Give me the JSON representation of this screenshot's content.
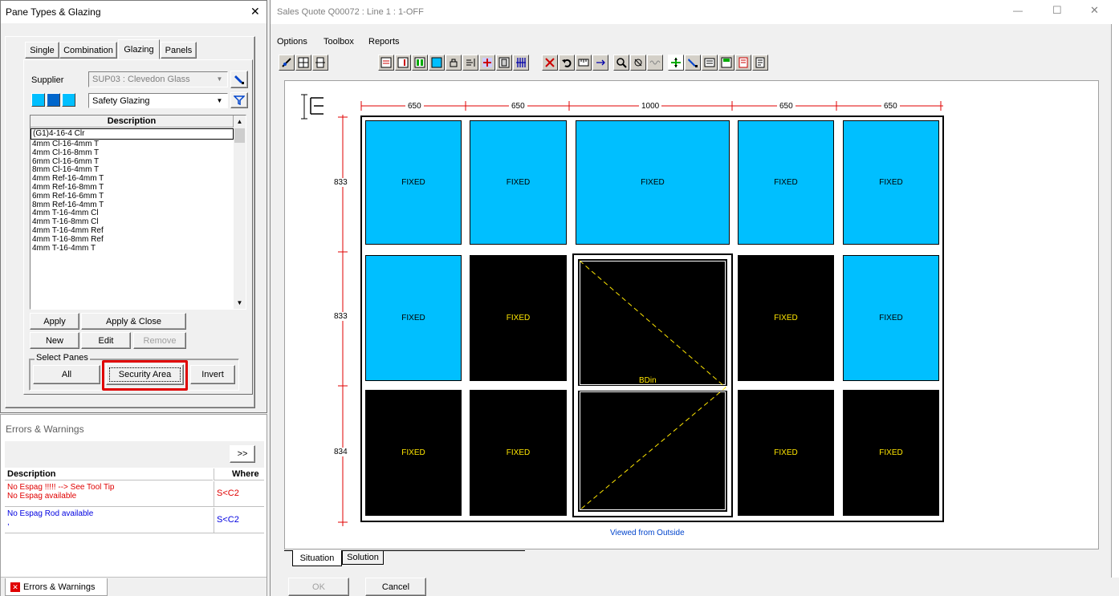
{
  "left_panel": {
    "title": "Pane Types & Glazing",
    "close_label": "✕",
    "tabs": [
      {
        "label": "Single"
      },
      {
        "label": "Combination"
      },
      {
        "label": "Glazing"
      },
      {
        "label": "Panels"
      }
    ],
    "supplier_label": "Supplier",
    "supplier_value": "SUP03 : Clevedon Glass",
    "category_value": "Safety Glazing",
    "list_header": "Description",
    "list_items": [
      "(G1)4-16-4 Clr",
      "4mm Cl-16-4mm T",
      "4mm Cl-16-8mm T",
      "6mm Cl-16-6mm T",
      "8mm Cl-16-4mm T",
      "4mm Ref-16-4mm T",
      "4mm Ref-16-8mm T",
      "6mm Ref-16-6mm T",
      "8mm Ref-16-4mm T",
      "4mm T-16-4mm Cl",
      "4mm T-16-8mm Cl",
      "4mm T-16-4mm Ref",
      "4mm T-16-8mm Ref",
      "4mm T-16-4mm T"
    ],
    "buttons": {
      "apply": "Apply",
      "apply_close": "Apply & Close",
      "new": "New",
      "edit": "Edit",
      "remove": "Remove"
    },
    "select_panes": {
      "legend": "Select Panes",
      "all": "All",
      "security_area": "Security Area",
      "invert": "Invert"
    }
  },
  "errors_panel": {
    "title": "Errors & Warnings",
    "expand_label": ">>",
    "col_description": "Description",
    "col_where": "Where",
    "rows": [
      {
        "line1": "No Espag !!!!!  --> See Tool Tip",
        "line2": "No Espag available",
        "where": "S<C2",
        "color": "#e00000"
      },
      {
        "line1": "No Espag Rod available",
        "line2": ",",
        "where": "S<C2",
        "color": "#0000e0"
      }
    ],
    "bottom_tab": "Errors & Warnings"
  },
  "main_window": {
    "title": "Sales Quote Q00072  : Line  1 : 1-OFF",
    "menu": [
      "Options",
      "Toolbox",
      "Reports"
    ],
    "window_controls": {
      "minimize": "—",
      "maximize": "☐",
      "close": "✕"
    },
    "colors": {
      "glass_blue": "#00bfff",
      "panel_black": "#000000",
      "label_yellow": "#ffe600",
      "dimension_red": "#e00000"
    },
    "top_dimensions": [
      "650",
      "650",
      "1000",
      "650",
      "650"
    ],
    "side_dimensions": [
      "833",
      "833",
      "834"
    ],
    "panes": {
      "row1": [
        "FIXED",
        "FIXED",
        "FIXED",
        "FIXED",
        "FIXED"
      ],
      "row2": [
        "FIXED",
        "FIXED",
        "FIXED",
        "FIXED"
      ],
      "row3": [
        "FIXED",
        "FIXED",
        "FIXED",
        "FIXED"
      ],
      "sash_label": "BDin"
    },
    "viewed_label": "Viewed from Outside",
    "bottom_tabs": [
      "Situation",
      "Solution"
    ],
    "ok_label": "OK",
    "cancel_label": "Cancel"
  }
}
